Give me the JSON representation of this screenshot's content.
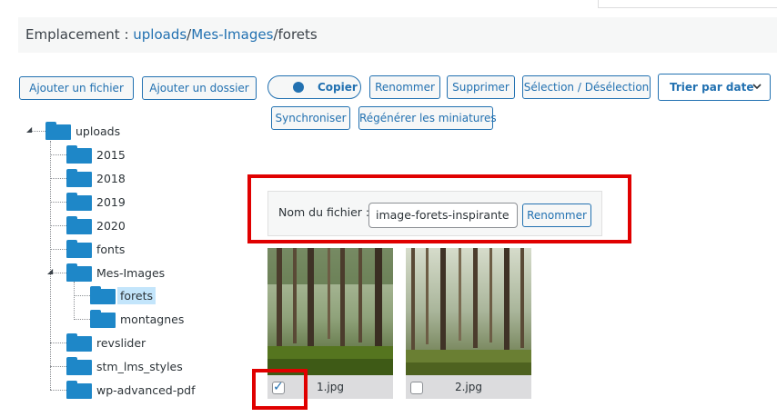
{
  "location": {
    "prefix": "Emplacement : ",
    "crumbs": [
      "uploads",
      "/",
      "Mes-Images",
      "/forets"
    ]
  },
  "toolbar": {
    "add_file": "Ajouter un fichier",
    "add_folder": "Ajouter un dossier",
    "copy_toggle": "Copier",
    "rename": "Renommer",
    "delete": "Supprimer",
    "select_toggle": "Sélection / Désélection",
    "sort": "Trier par date",
    "sync": "Synchroniser",
    "regen_thumbs": "Régénérer les miniatures"
  },
  "tree": {
    "root": "uploads",
    "items": [
      "2015",
      "2018",
      "2019",
      "2020",
      "fonts",
      "Mes-Images",
      "forets",
      "montagnes",
      "revslider",
      "stm_lms_styles",
      "wp-advanced-pdf"
    ]
  },
  "rename_panel": {
    "label": "Nom du fichier :",
    "value": "image-forets-inspirante",
    "button": "Renommer"
  },
  "files": [
    {
      "name": "1.jpg",
      "checked": true
    },
    {
      "name": "2.jpg",
      "checked": false
    }
  ],
  "colors": {
    "accent": "#2271b1",
    "folder": "#1e87c8",
    "highlight": "#e00000",
    "selected_bg": "#c3e5fb"
  }
}
